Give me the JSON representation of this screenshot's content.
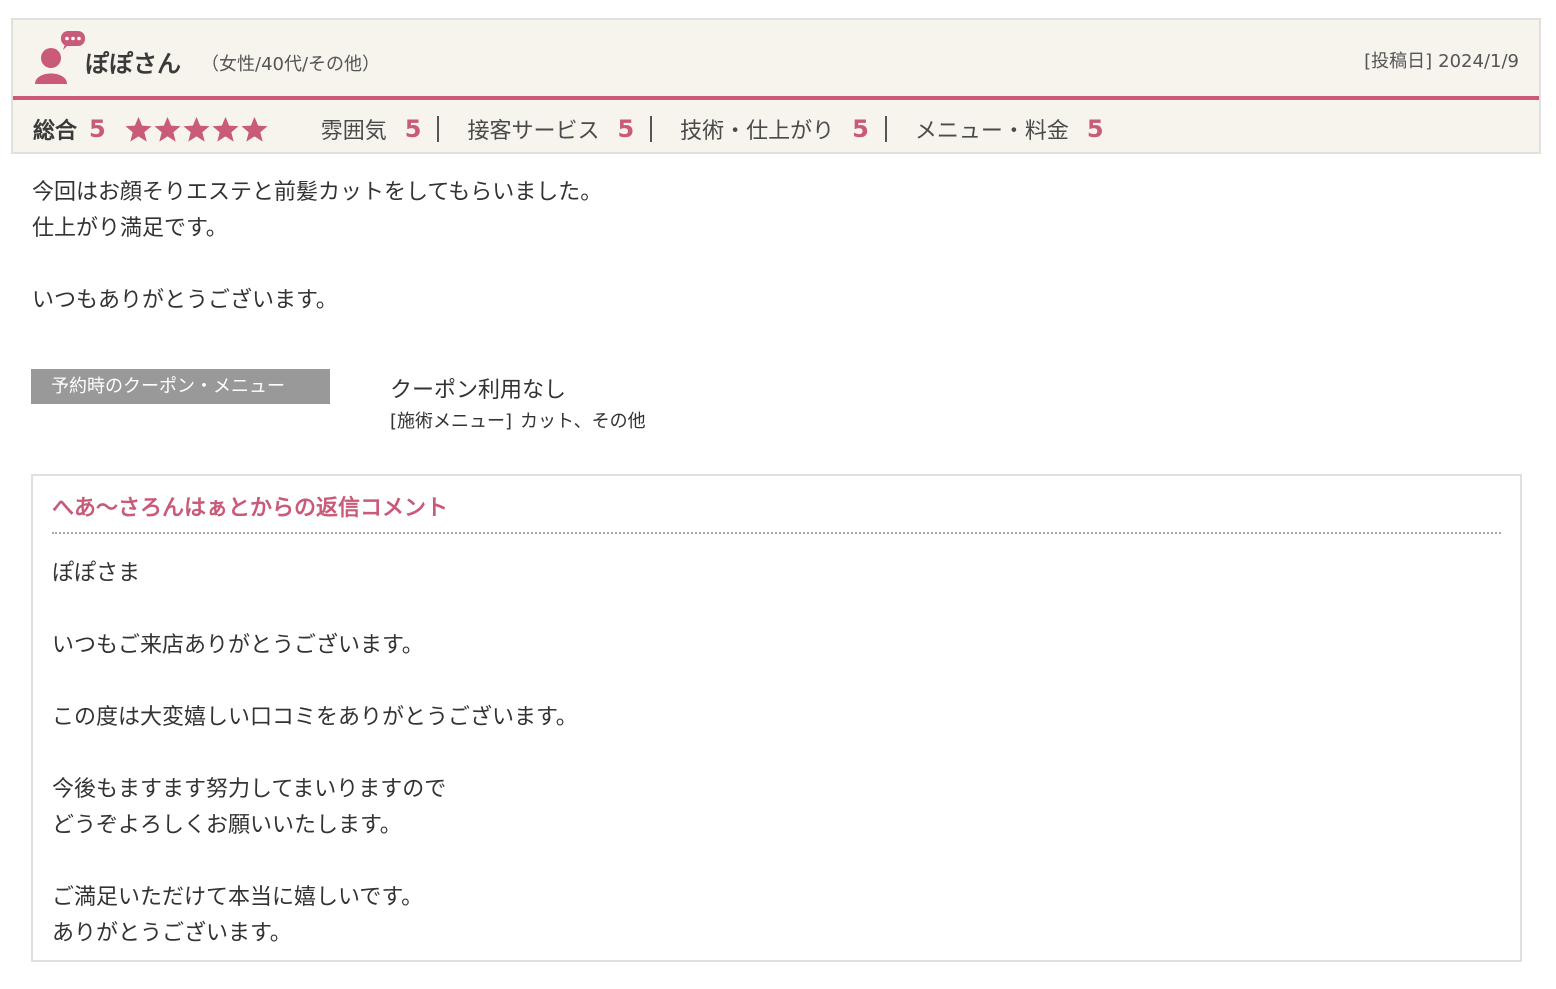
{
  "reviewer": {
    "name": "ぽぽさん",
    "attributes": "（女性/40代/その他）",
    "date_label": "[投稿日]",
    "date": "2024/1/9"
  },
  "ratings": {
    "overall_label": "総合",
    "overall_score": "5",
    "stars_filled": 5,
    "stars_total": 5,
    "items": [
      {
        "label": "雰囲気",
        "score": "5"
      },
      {
        "label": "接客サービス",
        "score": "5"
      },
      {
        "label": "技術・仕上がり",
        "score": "5"
      },
      {
        "label": "メニュー・料金",
        "score": "5"
      }
    ]
  },
  "review": {
    "body": "今回はお顔そりエステと前髪カットをしてもらいました。\n仕上がり満足です。\n\nいつもありがとうございます。"
  },
  "coupon": {
    "tag": "予約時のクーポン・メニュー",
    "status": "クーポン利用なし",
    "menu_label": "[施術メニュー]",
    "menu_value": "カット、その他"
  },
  "reply": {
    "title": "へあ〜さろんはぁとからの返信コメント",
    "body": "ぽぽさま\n\nいつもご来店ありがとうございます。\n\nこの度は大変嬉しい口コミをありがとうございます。\n\n今後もますます努力してまいりますので\nどうぞよろしくお願いいたします。\n\nご満足いただけて本当に嬉しいです。\nありがとうございます。"
  },
  "colors": {
    "accent": "#c95a78",
    "card_bg": "#f7f4ee",
    "tag_bg": "#999999"
  },
  "icons": {
    "avatar": "user-speech-icon",
    "star": "star-icon"
  }
}
